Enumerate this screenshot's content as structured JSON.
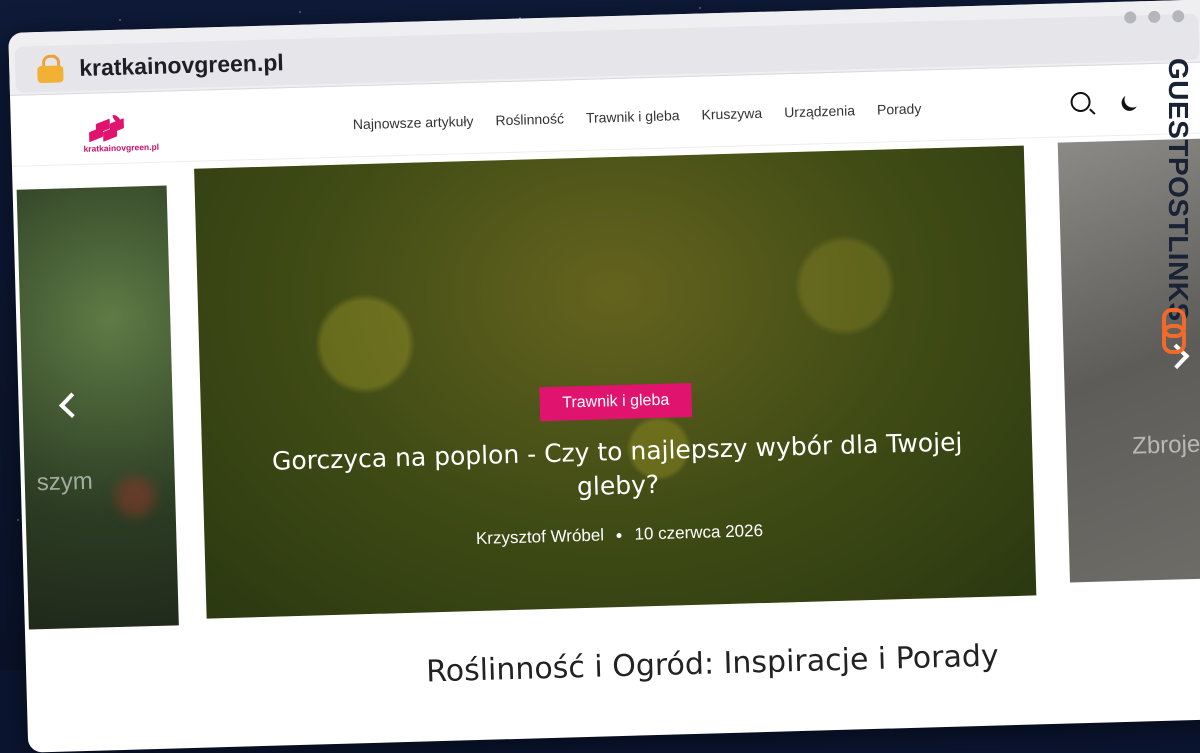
{
  "browser": {
    "url": "kratkainovgreen.pl"
  },
  "header": {
    "logo_text": "kratkainovgreen.pl",
    "nav": [
      "Najnowsze artykuły",
      "Roślinność",
      "Trawnik i gleba",
      "Kruszywa",
      "Urządzenia",
      "Porady"
    ]
  },
  "slider": {
    "prev_partial_text": "szym",
    "next_partial_text": "Zbroje",
    "hero": {
      "category": "Trawnik i gleba",
      "title": "Gorczyca na poplon - Czy to najlepszy wybór dla Twojej gleby?",
      "author": "Krzysztof Wróbel",
      "date": "10 czerwca 2026"
    }
  },
  "section": {
    "title": "Roślinność i Ogród: Inspiracje i Porady"
  },
  "watermark": {
    "text": "GUESTPOSTLINKS"
  },
  "colors": {
    "accent": "#e0146f",
    "watermark_accent": "#f06a2c"
  }
}
